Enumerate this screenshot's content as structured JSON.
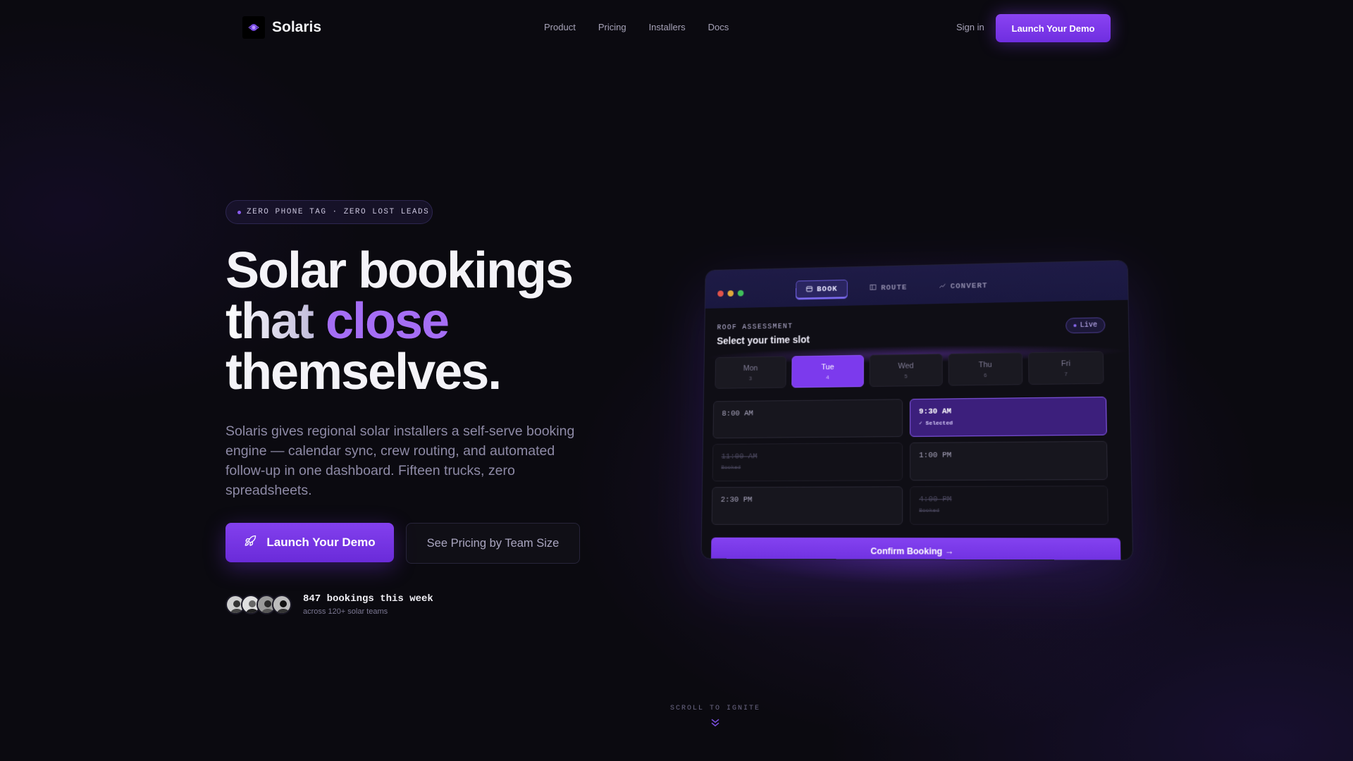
{
  "brand": {
    "name": "Solaris"
  },
  "nav": {
    "links": [
      "Product",
      "Pricing",
      "Installers",
      "Docs"
    ],
    "signin": "Sign in",
    "cta": "Launch Your Demo"
  },
  "hero": {
    "badge": "ZERO PHONE TAG · ZERO LOST LEADS",
    "headline": {
      "line1": "Solar bookings",
      "line2_a": "that ",
      "line2_b": "close",
      "line3": "themselves."
    },
    "subtitle": "Solaris gives regional solar installers a self-serve booking engine — calendar sync, crew routing, and automated follow-up in one dashboard. Fifteen trucks, zero spreadsheets.",
    "cta_primary": "Launch Your Demo",
    "cta_secondary": "See Pricing by Team Size",
    "proof": {
      "title": "847 bookings this week",
      "subtitle": "across 120+ solar teams"
    }
  },
  "widget": {
    "tabs": [
      {
        "label": "BOOK",
        "icon": "calendar-icon",
        "active": true
      },
      {
        "label": "ROUTE",
        "icon": "map-icon",
        "active": false
      },
      {
        "label": "CONVERT",
        "icon": "trend-icon",
        "active": false
      }
    ],
    "section_label": "ROOF ASSESSMENT",
    "title": "Select your time slot",
    "status": "Live",
    "days": [
      {
        "name": "Mon",
        "num": "3",
        "active": false
      },
      {
        "name": "Tue",
        "num": "4",
        "active": true
      },
      {
        "name": "Wed",
        "num": "5",
        "active": false
      },
      {
        "name": "Thu",
        "num": "6",
        "active": false
      },
      {
        "name": "Fri",
        "num": "7",
        "active": false
      }
    ],
    "slots": [
      {
        "time": "8:00 AM",
        "note": "",
        "state": "open"
      },
      {
        "time": "9:30 AM",
        "note": "✓ Selected",
        "state": "selected"
      },
      {
        "time": "11:00 AM",
        "note": "Booked",
        "state": "booked"
      },
      {
        "time": "1:00 PM",
        "note": "",
        "state": "open"
      },
      {
        "time": "2:30 PM",
        "note": "",
        "state": "open"
      },
      {
        "time": "4:00 PM",
        "note": "Booked",
        "state": "booked"
      }
    ],
    "confirm": "Confirm Booking →"
  },
  "scroll": {
    "label": "SCROLL TO IGNITE"
  },
  "colors": {
    "accent": "#7c3aed",
    "background": "#0b0a10",
    "accent_light": "#a56ef5"
  }
}
